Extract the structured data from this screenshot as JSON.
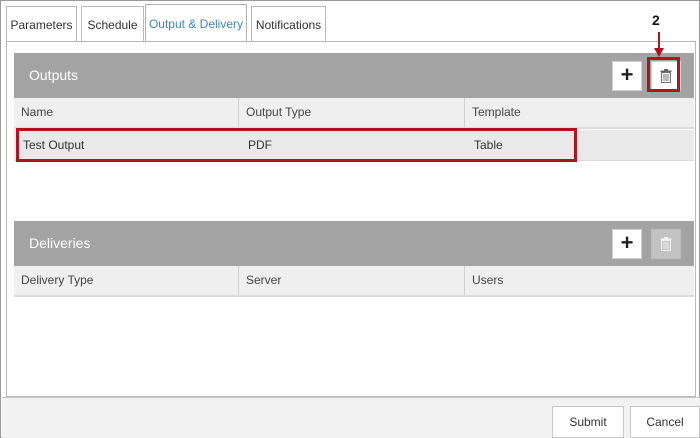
{
  "tabs": [
    {
      "label": "Parameters",
      "active": false
    },
    {
      "label": "Schedule",
      "active": false
    },
    {
      "label": "Output & Delivery",
      "active": true
    },
    {
      "label": "Notifications",
      "active": false
    }
  ],
  "outputs": {
    "title": "Outputs",
    "add_icon": "plus-icon",
    "delete_icon": "trash-icon",
    "columns": [
      "Name",
      "Output Type",
      "Template"
    ],
    "rows": [
      {
        "name": "Test Output",
        "output_type": "PDF",
        "template": "Table"
      }
    ]
  },
  "deliveries": {
    "title": "Deliveries",
    "add_icon": "plus-icon",
    "delete_icon": "trash-icon",
    "columns": [
      "Delivery Type",
      "Server",
      "Users"
    ]
  },
  "callout": {
    "number": "2",
    "color": "#b0131b"
  },
  "footer": {
    "submit_label": "Submit",
    "cancel_label": "Cancel"
  },
  "colors": {
    "accent": "#3b86c4",
    "header_bg": "#a3a3a3",
    "highlight": "#b0131b"
  }
}
